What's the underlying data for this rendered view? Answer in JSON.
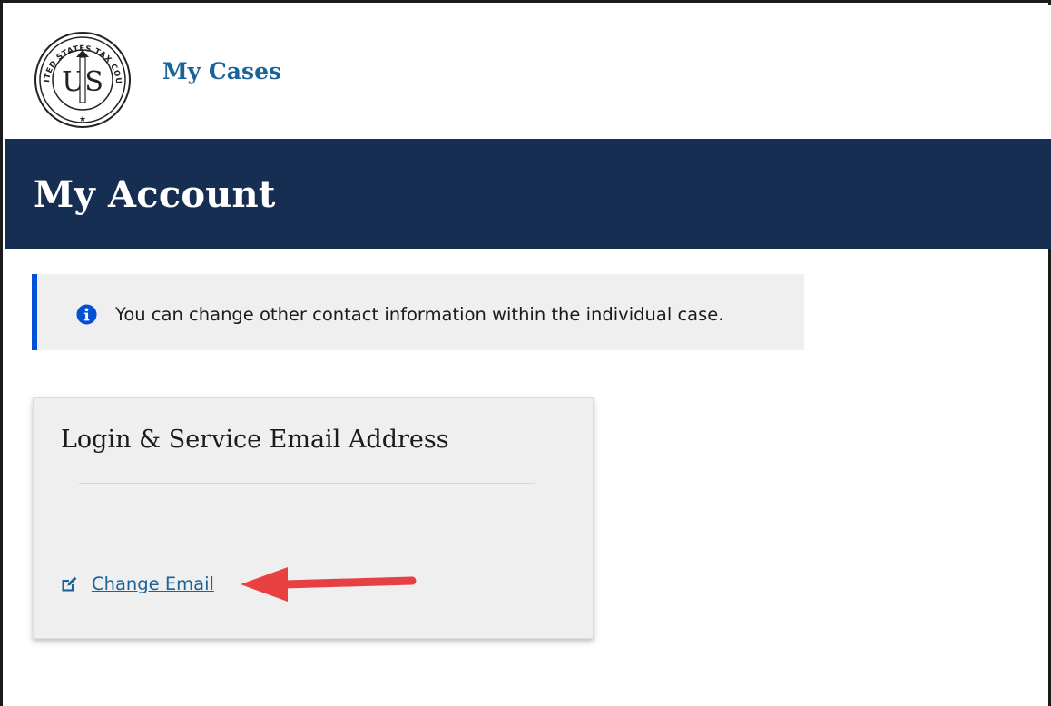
{
  "header": {
    "seal_text": "UNITED STATES TAX COURT",
    "seal_monogram": "US",
    "nav_link": "My Cases"
  },
  "banner": {
    "title": "My Account"
  },
  "alert": {
    "icon": "info-icon",
    "message": "You can change other contact information within the individual case.",
    "accent_color": "#0050d8"
  },
  "card": {
    "title": "Login & Service Email Address",
    "email": "",
    "change_link_icon": "edit-icon",
    "change_link_label": "Change Email"
  },
  "colors": {
    "banner_bg": "#162e51",
    "link": "#1a6399",
    "annotation_arrow": "#e84040"
  }
}
